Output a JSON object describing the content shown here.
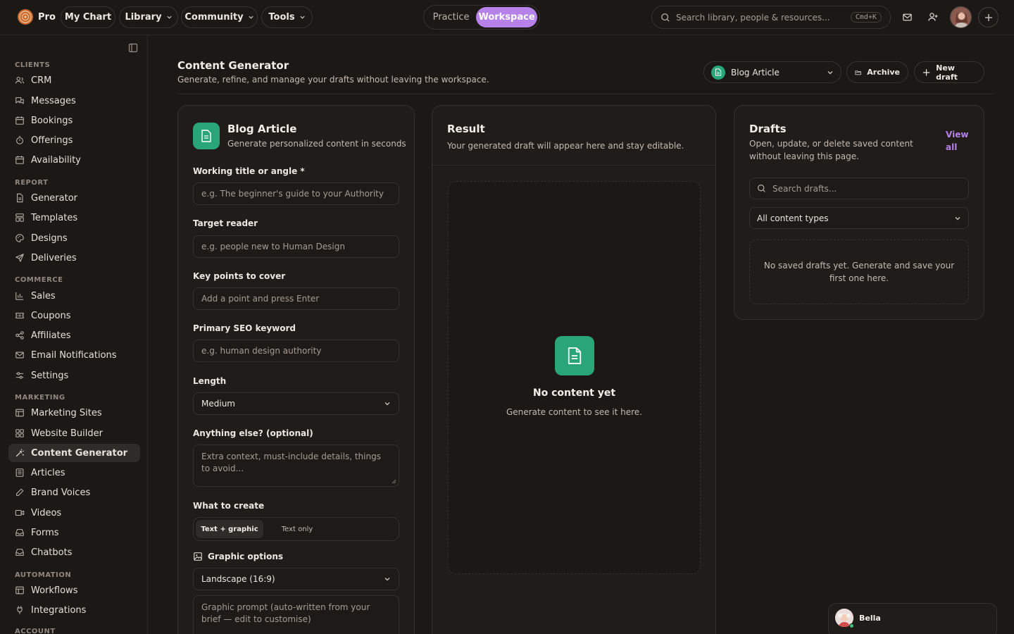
{
  "nav": {
    "brand": "Pro",
    "my_chart": "My Chart",
    "library": "Library",
    "community": "Community",
    "tools": "Tools",
    "mode_practice": "Practice",
    "mode_workspace": "Workspace",
    "search_placeholder": "Search library, people & resources...",
    "search_shortcut": "Cmd+K"
  },
  "sidebar": {
    "sections": [
      {
        "title": "CLIENTS",
        "items": [
          "CRM",
          "Messages",
          "Bookings",
          "Offerings",
          "Availability"
        ]
      },
      {
        "title": "REPORT",
        "items": [
          "Generator",
          "Templates",
          "Designs",
          "Deliveries"
        ]
      },
      {
        "title": "COMMERCE",
        "items": [
          "Sales",
          "Coupons",
          "Affiliates",
          "Email Notifications",
          "Settings"
        ]
      },
      {
        "title": "MARKETING",
        "items": [
          "Marketing Sites",
          "Website Builder",
          "Content Generator",
          "Articles",
          "Brand Voices",
          "Videos",
          "Forms",
          "Chatbots"
        ]
      },
      {
        "title": "AUTOMATION",
        "items": [
          "Workflows",
          "Integrations"
        ]
      },
      {
        "title": "ACCOUNT",
        "items": []
      }
    ],
    "active_item": "Content Generator"
  },
  "header": {
    "title": "Content Generator",
    "subtitle": "Generate, refine, and manage your drafts without leaving the workspace.",
    "type_select": "Blog Article",
    "archive": "Archive",
    "new_draft": "New draft"
  },
  "form": {
    "title": "Blog Article",
    "subtitle": "Generate personalized content in seconds",
    "working_title_label": "Working title or angle *",
    "working_title_placeholder": "e.g. The beginner's guide to your Authority",
    "target_reader_label": "Target reader",
    "target_reader_placeholder": "e.g. people new to Human Design",
    "key_points_label": "Key points to cover",
    "key_points_placeholder": "Add a point and press Enter",
    "seo_label": "Primary SEO keyword",
    "seo_placeholder": "e.g. human design authority",
    "length_label": "Length",
    "length_value": "Medium",
    "else_label": "Anything else? (optional)",
    "else_placeholder": "Extra context, must-include details, things to avoid...",
    "create_label": "What to create",
    "create_options": [
      "Text + graphic",
      "Text only"
    ],
    "create_selected": "Text + graphic",
    "graphic_label": "Graphic options",
    "graphic_ratio": "Landscape (16:9)",
    "graphic_prompt_placeholder": "Graphic prompt (auto-written from your brief — edit to customise)"
  },
  "result": {
    "title": "Result",
    "subtitle": "Your generated draft will appear here and stay editable.",
    "empty_title": "No content yet",
    "empty_subtitle": "Generate content to see it here."
  },
  "drafts": {
    "title": "Drafts",
    "subtitle": "Open, update, or delete saved content without leaving this page.",
    "view_all": "View all",
    "search_placeholder": "Search drafts...",
    "filter_value": "All content types",
    "empty": "No saved drafts yet. Generate and save your first one here."
  },
  "chat": {
    "name": "Bella"
  },
  "colors": {
    "accent": "#b681e8",
    "brand_green": "#2aa57a",
    "background": "#1b1816"
  }
}
